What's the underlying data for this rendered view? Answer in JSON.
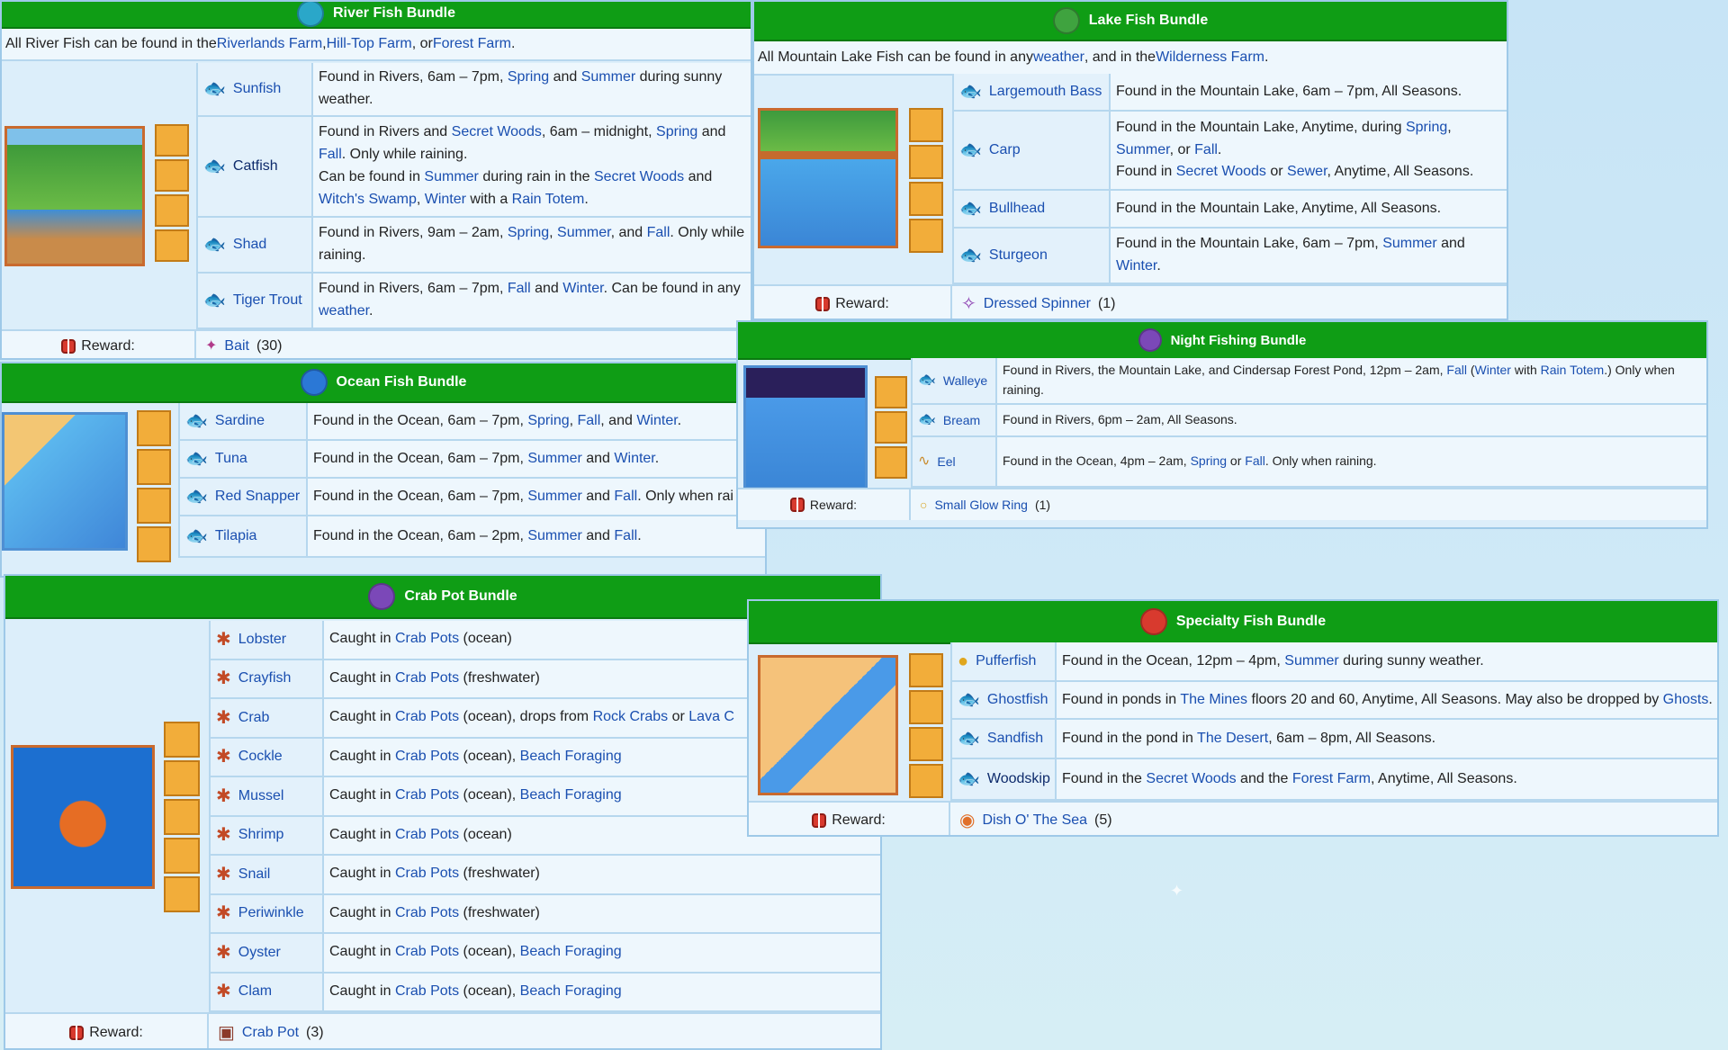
{
  "labels": {
    "reward": "Reward:"
  },
  "colors": {
    "header_green": "#0f9d15",
    "link_blue": "#1a4fb0",
    "slot_orange": "#f2ad3a"
  },
  "river": {
    "title": "River Fish Bundle",
    "intro": {
      "t1": "All River Fish can be found in the ",
      "l1": "Riverlands Farm",
      "t2": ", ",
      "l2": "Hill-Top Farm",
      "t3": ", or ",
      "l3": "Forest Farm",
      "t4": "."
    },
    "fish": [
      {
        "name": "Sunfish",
        "icon": "🐟"
      },
      {
        "name": "Catfish",
        "icon": "🐟"
      },
      {
        "name": "Shad",
        "icon": "🐟"
      },
      {
        "name": "Tiger Trout",
        "icon": "🐟"
      }
    ],
    "d0": {
      "a": "Found in Rivers, 6am – 7pm, ",
      "l1": "Spring",
      "b": " and ",
      "l2": "Summer",
      "c": " during sunny weather."
    },
    "d1": {
      "a": "Found in Rivers and ",
      "l1": "Secret Woods",
      "b": ", 6am – midnight, ",
      "l2": "Spring",
      "c": " and ",
      "l3": "Fall",
      "d": ". Only while raining.",
      "e": "Can be found in ",
      "l4": "Summer",
      "f": " during rain in the ",
      "l5": "Secret Woods",
      "g": " and ",
      "l6": "Witch's Swamp",
      "h": ", ",
      "l7": "Winter",
      "i": " with a ",
      "l8": "Rain Totem",
      "j": "."
    },
    "d2": {
      "a": "Found in Rivers, 9am – 2am, ",
      "l1": "Spring",
      "b": ", ",
      "l2": "Summer",
      "c": ", and ",
      "l3": "Fall",
      "d": ". Only while raining."
    },
    "d3": {
      "a": "Found in Rivers, 6am – 7pm, ",
      "l1": "Fall",
      "b": " and ",
      "l2": "Winter",
      "c": ". Can be found in any ",
      "l3": "weather",
      "d": "."
    },
    "reward": {
      "item": "Bait",
      "qty": "(30)"
    }
  },
  "lake": {
    "title": "Lake Fish Bundle",
    "intro": {
      "t1": "All Mountain Lake Fish can be found in any ",
      "l1": "weather",
      "t2": ", and in the ",
      "l2": "Wilderness Farm",
      "t3": "."
    },
    "fish": [
      {
        "name": "Largemouth Bass"
      },
      {
        "name": "Carp"
      },
      {
        "name": "Bullhead"
      },
      {
        "name": "Sturgeon"
      }
    ],
    "d0": {
      "a": "Found in the Mountain Lake, 6am – 7pm, All Seasons."
    },
    "d1": {
      "a": "Found in the Mountain Lake, Anytime, during ",
      "l1": "Spring",
      "b": ",",
      "l2": "Summer",
      "c": ", or ",
      "l3": "Fall",
      "d": ".",
      "e": "Found in ",
      "l4": "Secret Woods",
      "f": " or ",
      "l5": "Sewer",
      "g": ", Anytime, All Seasons."
    },
    "d2": {
      "a": "Found in the Mountain Lake, Anytime, All Seasons."
    },
    "d3": {
      "a": "Found in the Mountain Lake, 6am – 7pm, ",
      "l1": "Summer",
      "b": " and",
      "l2": "Winter",
      "c": "."
    },
    "reward": {
      "item": "Dressed Spinner",
      "qty": "(1)"
    }
  },
  "night": {
    "title": "Night Fishing Bundle",
    "fish": [
      {
        "name": "Walleye"
      },
      {
        "name": "Bream"
      },
      {
        "name": "Eel"
      }
    ],
    "d0": {
      "a": "Found in Rivers, the Mountain Lake, and Cindersap Forest Pond, 12pm – 2am, ",
      "l1": "Fall",
      "b": " (",
      "l2": "Winter",
      "c": " with ",
      "l3": "Rain Totem",
      "d": ".) Only when raining."
    },
    "d1": {
      "a": "Found in Rivers, 6pm – 2am, All Seasons."
    },
    "d2": {
      "a": "Found in the Ocean, 4pm – 2am, ",
      "l1": "Spring",
      "b": " or ",
      "l2": "Fall",
      "c": ". Only when raining."
    },
    "reward": {
      "item": "Small Glow Ring",
      "qty": "(1)"
    }
  },
  "ocean": {
    "title": "Ocean Fish Bundle",
    "fish": [
      {
        "name": "Sardine"
      },
      {
        "name": "Tuna"
      },
      {
        "name": "Red Snapper"
      },
      {
        "name": "Tilapia"
      }
    ],
    "d0": {
      "a": "Found in the Ocean, 6am – 7pm, ",
      "l1": "Spring",
      "b": ", ",
      "l2": "Fall",
      "c": ", and ",
      "l3": "Winter",
      "d": "."
    },
    "d1": {
      "a": "Found in the Ocean, 6am – 7pm, ",
      "l1": "Summer",
      "b": " and ",
      "l2": "Winter",
      "c": "."
    },
    "d2": {
      "a": "Found in the Ocean, 6am – 7pm, ",
      "l1": "Summer",
      "b": " and ",
      "l2": "Fall",
      "c": ". Only when rai"
    },
    "d3": {
      "a": "Found in the Ocean, 6am – 2pm, ",
      "l1": "Summer",
      "b": " and ",
      "l2": "Fall",
      "c": "."
    }
  },
  "crab": {
    "title": "Crab Pot Bundle",
    "caught": "Caught in ",
    "crabpots": "Crab Pots",
    "fish": [
      {
        "name": "Lobster",
        "suffix": " (ocean)",
        "extra": ""
      },
      {
        "name": "Crayfish",
        "suffix": " (freshwater)",
        "extra": ""
      },
      {
        "name": "Crab",
        "suffix": " (ocean), drops from ",
        "extra": ""
      },
      {
        "name": "Cockle",
        "suffix": " (ocean), ",
        "extra": "Beach Foraging"
      },
      {
        "name": "Mussel",
        "suffix": " (ocean), ",
        "extra": "Beach Foraging"
      },
      {
        "name": "Shrimp",
        "suffix": " (ocean)",
        "extra": ""
      },
      {
        "name": "Snail",
        "suffix": " (freshwater)",
        "extra": ""
      },
      {
        "name": "Periwinkle",
        "suffix": " (freshwater)",
        "extra": ""
      },
      {
        "name": "Oyster",
        "suffix": " (ocean), ",
        "extra": "Beach Foraging"
      },
      {
        "name": "Clam",
        "suffix": " (ocean), ",
        "extra": "Beach Foraging"
      }
    ],
    "crab_extra": {
      "l1": "Rock Crabs",
      "b": " or ",
      "l2": "Lava C"
    },
    "reward": {
      "item": "Crab Pot",
      "qty": "(3)"
    }
  },
  "specialty": {
    "title": "Specialty Fish Bundle",
    "fish": [
      {
        "name": "Pufferfish"
      },
      {
        "name": "Ghostfish"
      },
      {
        "name": "Sandfish"
      },
      {
        "name": "Woodskip"
      }
    ],
    "d0": {
      "a": "Found in the Ocean, 12pm – 4pm, ",
      "l1": "Summer",
      "b": " during sunny weather."
    },
    "d1": {
      "a": "Found in ponds in ",
      "l1": "The Mines",
      "b": " floors 20 and 60, Anytime, All Seasons. May also be dropped by ",
      "l2": "Ghosts",
      "c": "."
    },
    "d2": {
      "a": "Found in the pond in ",
      "l1": "The Desert",
      "b": ", 6am – 8pm, All Seasons."
    },
    "d3": {
      "a": "Found in the ",
      "l1": "Secret Woods",
      "b": " and the ",
      "l2": "Forest Farm",
      "c": ", Anytime, All Seasons."
    },
    "reward": {
      "item": "Dish O' The Sea",
      "qty": "(5)"
    }
  }
}
